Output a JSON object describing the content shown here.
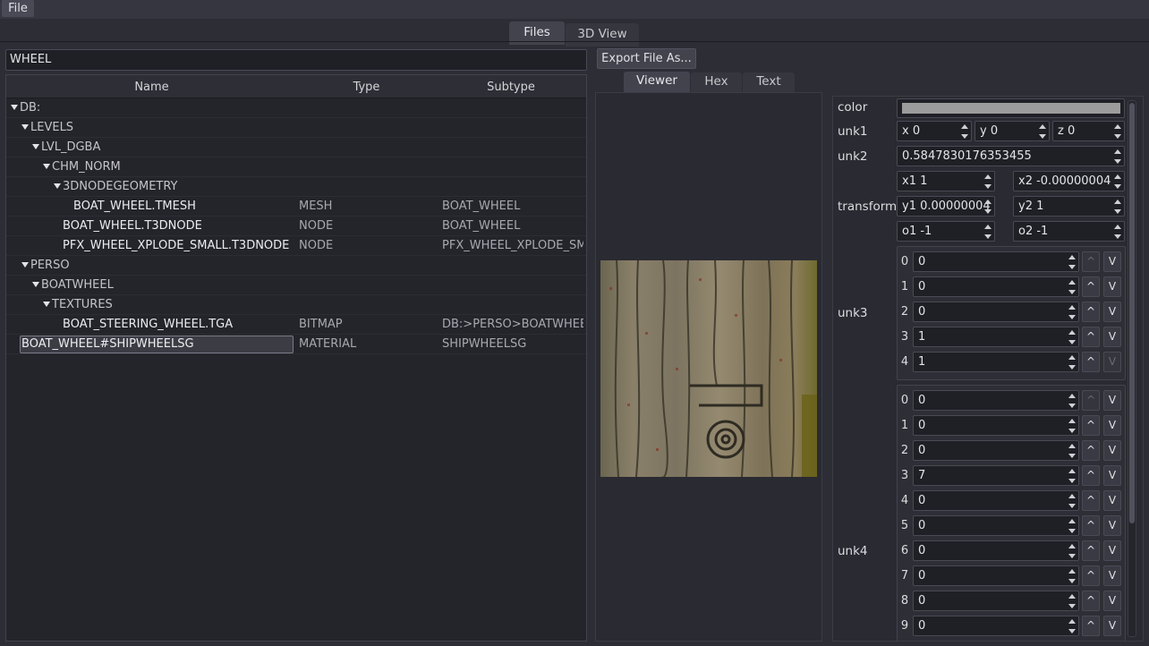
{
  "menu": {
    "file": "File"
  },
  "main_tabs": [
    {
      "label": "Files",
      "active": true
    },
    {
      "label": "3D View",
      "active": false
    }
  ],
  "search": {
    "value": "WHEEL"
  },
  "tree": {
    "columns": [
      "Name",
      "Type",
      "Subtype"
    ],
    "rows": [
      {
        "name": "DB:",
        "type": "",
        "subtype": "",
        "expanded": true
      },
      {
        "name": "LEVELS",
        "type": "",
        "subtype": "",
        "expanded": true
      },
      {
        "name": "LVL_DGBA",
        "type": "",
        "subtype": "",
        "expanded": true
      },
      {
        "name": "CHM_NORM",
        "type": "",
        "subtype": "",
        "expanded": true
      },
      {
        "name": "3DNODEGEOMETRY",
        "type": "",
        "subtype": "",
        "expanded": true
      },
      {
        "name": "BOAT_WHEEL.TMESH",
        "type": "MESH",
        "subtype": "BOAT_WHEEL"
      },
      {
        "name": "BOAT_WHEEL.T3DNODE",
        "type": "NODE",
        "subtype": "BOAT_WHEEL"
      },
      {
        "name": "PFX_WHEEL_XPLODE_SMALL.T3DNODE",
        "type": "NODE",
        "subtype": "PFX_WHEEL_XPLODE_SM"
      },
      {
        "name": "PERSO",
        "type": "",
        "subtype": "",
        "expanded": true
      },
      {
        "name": "BOATWHEEL",
        "type": "",
        "subtype": "",
        "expanded": true
      },
      {
        "name": "TEXTURES",
        "type": "",
        "subtype": "",
        "expanded": true
      },
      {
        "name": "BOAT_STEERING_WHEEL.TGA",
        "type": "BITMAP",
        "subtype": "DB:>PERSO>BOATWHEE"
      },
      {
        "name": "BOAT_WHEEL#SHIPWHEELSG",
        "type": "MATERIAL",
        "subtype": "SHIPWHEELSG",
        "selected": true
      }
    ]
  },
  "export_button": "Export File As...",
  "viewer_tabs": [
    {
      "label": "Viewer",
      "active": true
    },
    {
      "label": "Hex",
      "active": false
    },
    {
      "label": "Text",
      "active": false
    }
  ],
  "viewer": {
    "image_name": "wood-texture-image"
  },
  "properties": {
    "color_label": "color",
    "color_value": "#9c9c9c",
    "unk1": {
      "label": "unk1",
      "x": "x 0",
      "y": "y 0",
      "z": "z 0"
    },
    "unk2": {
      "label": "unk2",
      "value": "0.5847830176353455"
    },
    "transform": {
      "label": "transform",
      "x1": "x1 1",
      "x2": "x2 -0.00000004",
      "y1": "y1 0.00000004",
      "y2": "y2 1",
      "o1": "o1 -1",
      "o2": "o2 -1"
    },
    "unk3": {
      "label": "unk3",
      "values": [
        "0",
        "0",
        "0",
        "1",
        "1"
      ]
    },
    "unk4": {
      "label": "unk4",
      "values": [
        "0",
        "0",
        "0",
        "7",
        "0",
        "0",
        "0",
        "0",
        "0",
        "0"
      ]
    },
    "up_glyph": "^",
    "down_glyph": "V"
  }
}
